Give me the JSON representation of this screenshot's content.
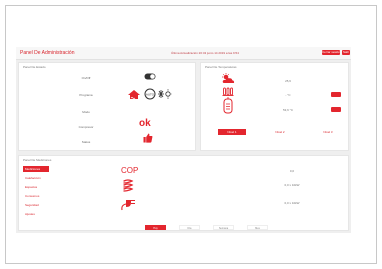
{
  "header": {
    "title": "Panel De Administración",
    "update_info": "Última Actualización 20:43 junio 14 2019 a las 9:54",
    "buttons": [
      "Cerrar sesión",
      "Salir"
    ]
  },
  "status_panel": {
    "title": "Panel De Estado",
    "labels": [
      "On/Off",
      "Programa",
      "Modo",
      "Compresor",
      "Status"
    ],
    "status_text": "ok",
    "mode_text": "AUTO"
  },
  "temperature_panel": {
    "title": "Panel De Temperaturas",
    "values": [
      "25,6",
      "- °C",
      "53,6 °C"
    ],
    "levels": [
      "Nivel 1",
      "Nivel 2",
      "Nivel 3"
    ],
    "active_level": 0
  },
  "measurement_panel": {
    "title": "Panel De Mediciones",
    "sidebar": [
      "Mediciones",
      "Calefacción",
      "Espacios",
      "Consumos",
      "Seguridad",
      "Ajustes"
    ],
    "active_item": 0,
    "cop_label": "COP",
    "values": [
      "0,0",
      "0,0 x 10kW",
      "0,0 x 10kW"
    ],
    "tabs": [
      "Hoy",
      "Día",
      "Semana",
      "Mes"
    ],
    "active_tab": 0
  },
  "colors": {
    "accent": "#e3262e",
    "panel_bg": "#ffffff",
    "app_bg": "#efefef"
  },
  "icons": [
    "toggle-icon",
    "home-heat-icon",
    "auto-mode-icon",
    "snow-sun-icon",
    "thumbs-up-icon",
    "sun-cloud-icon",
    "radiator-icon",
    "water-tank-icon",
    "heat-wave-icon",
    "plug-icon"
  ]
}
